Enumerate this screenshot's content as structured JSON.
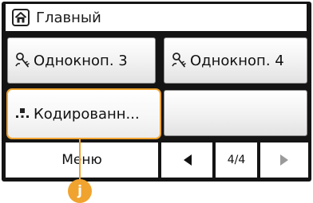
{
  "header": {
    "title": "Главный",
    "icon": "home-icon"
  },
  "tiles": [
    {
      "label": "Однокноп. 3",
      "icon": "user-key-icon"
    },
    {
      "label": "Однокноп. 4",
      "icon": "user-key-icon"
    },
    {
      "label": "Кодированн...",
      "icon": "coded-dial-icon"
    },
    {
      "label": ""
    }
  ],
  "footer": {
    "menu_label": "Меню",
    "page_indicator": "4/4",
    "prev_icon": "triangle-left-icon",
    "next_icon": "triangle-right-icon"
  },
  "callout": {
    "letter": "j"
  },
  "colors": {
    "highlight": "#f0a32e",
    "frame": "#141414"
  }
}
